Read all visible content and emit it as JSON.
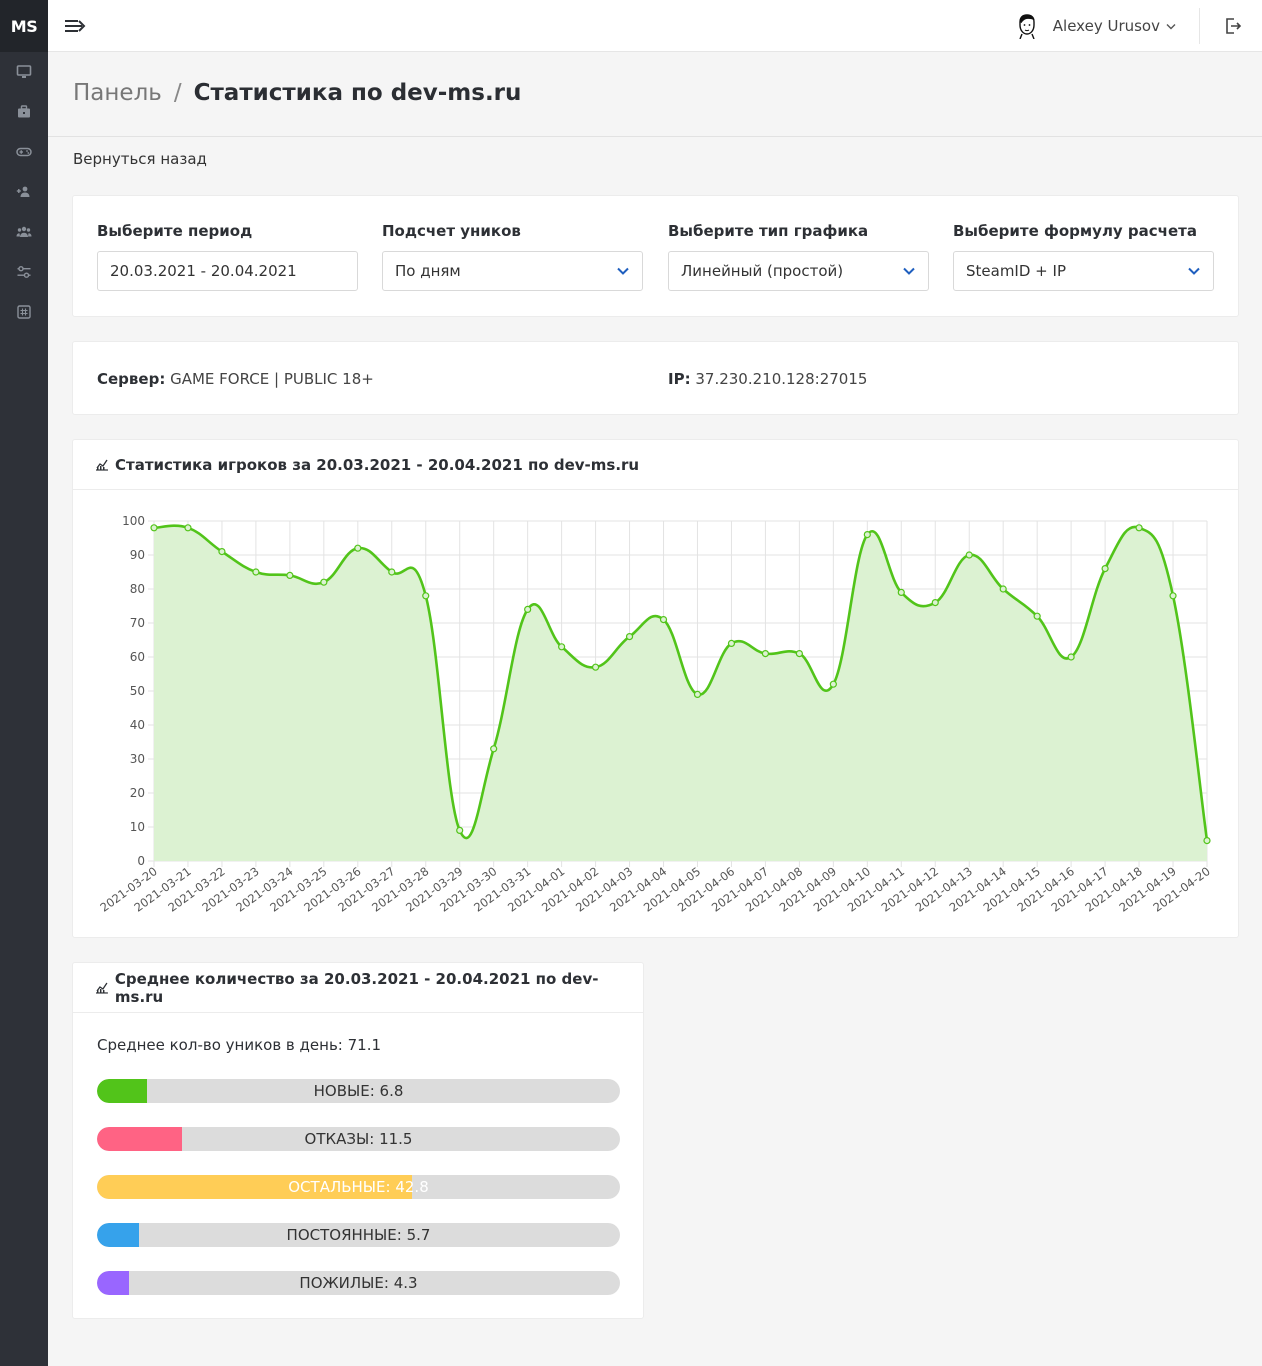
{
  "app": {
    "logo": "MS"
  },
  "sidebar": {
    "items": [
      {
        "icon": "monitor-icon"
      },
      {
        "icon": "briefcase-icon"
      },
      {
        "icon": "gamepad-icon"
      },
      {
        "icon": "user-add-icon"
      },
      {
        "icon": "users-icon"
      },
      {
        "icon": "sliders-icon"
      },
      {
        "icon": "hash-icon"
      }
    ]
  },
  "header": {
    "user_name": "Alexey Urusov"
  },
  "breadcrumb": {
    "root": "Панель",
    "separator": "/",
    "current": "Статистика по dev-ms.ru"
  },
  "back_link": "Вернуться назад",
  "filters": {
    "period": {
      "label": "Выберите период",
      "value": "20.03.2021 - 20.04.2021"
    },
    "count": {
      "label": "Подсчет уников",
      "value": "По дням"
    },
    "chart_type": {
      "label": "Выберите тип графика",
      "value": "Линейный (простой)"
    },
    "formula": {
      "label": "Выберите формулу расчета",
      "value": "SteamID + IP"
    }
  },
  "server": {
    "label": "Сервер:",
    "value": "GAME FORCE | PUBLIC 18+",
    "ip_label": "IP:",
    "ip_value": "37.230.210.128:27015"
  },
  "chart_card": {
    "title": "Статистика игроков за 20.03.2021 - 20.04.2021 по dev-ms.ru"
  },
  "chart_data": {
    "type": "area",
    "x": [
      "2021-03-20",
      "2021-03-21",
      "2021-03-22",
      "2021-03-23",
      "2021-03-24",
      "2021-03-25",
      "2021-03-26",
      "2021-03-27",
      "2021-03-28",
      "2021-03-29",
      "2021-03-30",
      "2021-03-31",
      "2021-04-01",
      "2021-04-02",
      "2021-04-03",
      "2021-04-04",
      "2021-04-05",
      "2021-04-06",
      "2021-04-07",
      "2021-04-08",
      "2021-04-09",
      "2021-04-10",
      "2021-04-11",
      "2021-04-12",
      "2021-04-13",
      "2021-04-14",
      "2021-04-15",
      "2021-04-16",
      "2021-04-17",
      "2021-04-18",
      "2021-04-19",
      "2021-04-20"
    ],
    "values": [
      98,
      98,
      91,
      85,
      84,
      82,
      92,
      85,
      78,
      9,
      33,
      74,
      63,
      57,
      66,
      71,
      49,
      64,
      61,
      61,
      52,
      96,
      79,
      76,
      90,
      80,
      72,
      60,
      86,
      98,
      78,
      6
    ],
    "ylim": [
      0,
      100
    ],
    "yticks": [
      0,
      10,
      20,
      30,
      40,
      50,
      60,
      70,
      80,
      90,
      100
    ],
    "grid": true,
    "line_color": "#52c41a",
    "fill_color": "#dcf2d2"
  },
  "avg_card": {
    "title": "Среднее количество за 20.03.2021 - 20.04.2021 по dev-ms.ru",
    "summary": "Среднее кол-во уников в день: 71.1",
    "bars": [
      {
        "label": "НОВЫЕ: 6.8",
        "value": 6.8,
        "color": "#52c41a"
      },
      {
        "label": "ОТКАЗЫ: 11.5",
        "value": 11.5,
        "color": "#ff6384"
      },
      {
        "label": "ОСТАЛЬНЫЕ: 42.8",
        "value": 42.8,
        "color": "#ffcd56"
      },
      {
        "label": "ПОСТОЯННЫЕ: 5.7",
        "value": 5.7,
        "color": "#36a2eb"
      },
      {
        "label": "ПОЖИЛЫЕ: 4.3",
        "value": 4.3,
        "color": "#9966ff"
      }
    ],
    "max": 71.1
  }
}
